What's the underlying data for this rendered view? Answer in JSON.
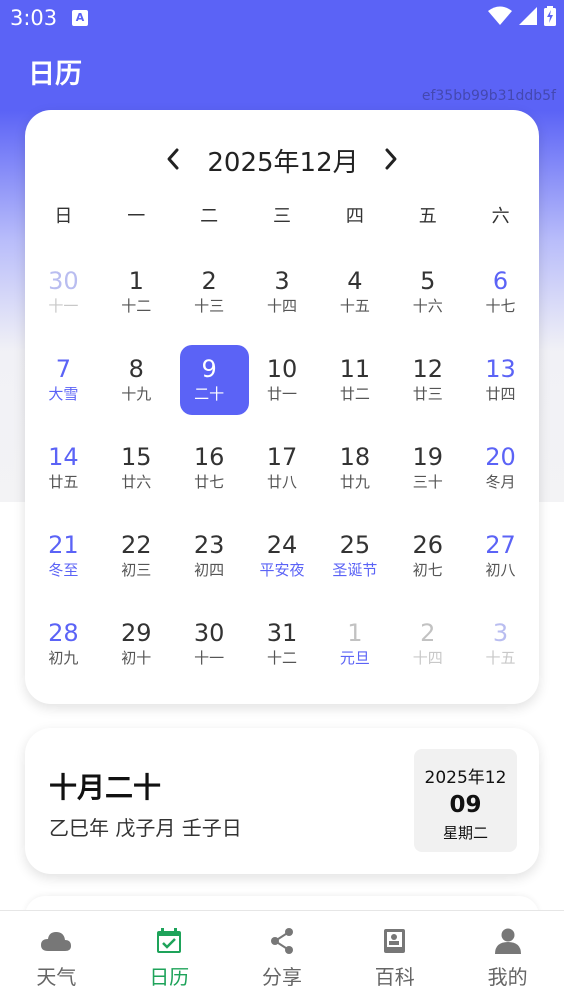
{
  "status_bar": {
    "time": "3:03",
    "notification_glyph": "A"
  },
  "header": {
    "title": "日历",
    "hash": "ef35bb99b31ddb5f"
  },
  "calendar": {
    "month_title": "2025年12月",
    "weekdays": [
      "日",
      "一",
      "二",
      "三",
      "四",
      "五",
      "六"
    ],
    "days": [
      {
        "num": "30",
        "lunar": "十一",
        "other": true,
        "weekend": true
      },
      {
        "num": "1",
        "lunar": "十二"
      },
      {
        "num": "2",
        "lunar": "十三"
      },
      {
        "num": "3",
        "lunar": "十四"
      },
      {
        "num": "4",
        "lunar": "十五"
      },
      {
        "num": "5",
        "lunar": "十六"
      },
      {
        "num": "6",
        "lunar": "十七",
        "weekend": true
      },
      {
        "num": "7",
        "lunar": "大雪",
        "weekend": true,
        "festival": true
      },
      {
        "num": "8",
        "lunar": "十九"
      },
      {
        "num": "9",
        "lunar": "二十",
        "selected": true
      },
      {
        "num": "10",
        "lunar": "廿一"
      },
      {
        "num": "11",
        "lunar": "廿二"
      },
      {
        "num": "12",
        "lunar": "廿三"
      },
      {
        "num": "13",
        "lunar": "廿四",
        "weekend": true
      },
      {
        "num": "14",
        "lunar": "廿五",
        "weekend": true
      },
      {
        "num": "15",
        "lunar": "廿六"
      },
      {
        "num": "16",
        "lunar": "廿七"
      },
      {
        "num": "17",
        "lunar": "廿八"
      },
      {
        "num": "18",
        "lunar": "廿九"
      },
      {
        "num": "19",
        "lunar": "三十"
      },
      {
        "num": "20",
        "lunar": "冬月",
        "weekend": true
      },
      {
        "num": "21",
        "lunar": "冬至",
        "weekend": true,
        "festival": true
      },
      {
        "num": "22",
        "lunar": "初三"
      },
      {
        "num": "23",
        "lunar": "初四"
      },
      {
        "num": "24",
        "lunar": "平安夜",
        "festival": true
      },
      {
        "num": "25",
        "lunar": "圣诞节",
        "festival": true
      },
      {
        "num": "26",
        "lunar": "初七"
      },
      {
        "num": "27",
        "lunar": "初八",
        "weekend": true
      },
      {
        "num": "28",
        "lunar": "初九",
        "weekend": true
      },
      {
        "num": "29",
        "lunar": "初十"
      },
      {
        "num": "30",
        "lunar": "十一"
      },
      {
        "num": "31",
        "lunar": "十二"
      },
      {
        "num": "1",
        "lunar": "元旦",
        "other": true,
        "festival": true
      },
      {
        "num": "2",
        "lunar": "十四",
        "other": true
      },
      {
        "num": "3",
        "lunar": "十五",
        "other": true,
        "weekend": true
      }
    ]
  },
  "info": {
    "lunar_date": "十月二十",
    "ganzhi": "乙巳年 戊子月 壬子日",
    "year_month": "2025年12",
    "day": "09",
    "weekday": "星期二"
  },
  "bottom_nav": [
    {
      "label": "天气",
      "icon": "cloud-icon"
    },
    {
      "label": "日历",
      "icon": "calendar-icon",
      "active": true
    },
    {
      "label": "分享",
      "icon": "share-icon"
    },
    {
      "label": "百科",
      "icon": "book-icon"
    },
    {
      "label": "我的",
      "icon": "person-icon"
    }
  ],
  "colors": {
    "accent": "#5b63f6",
    "active_nav": "#1ea35a"
  }
}
